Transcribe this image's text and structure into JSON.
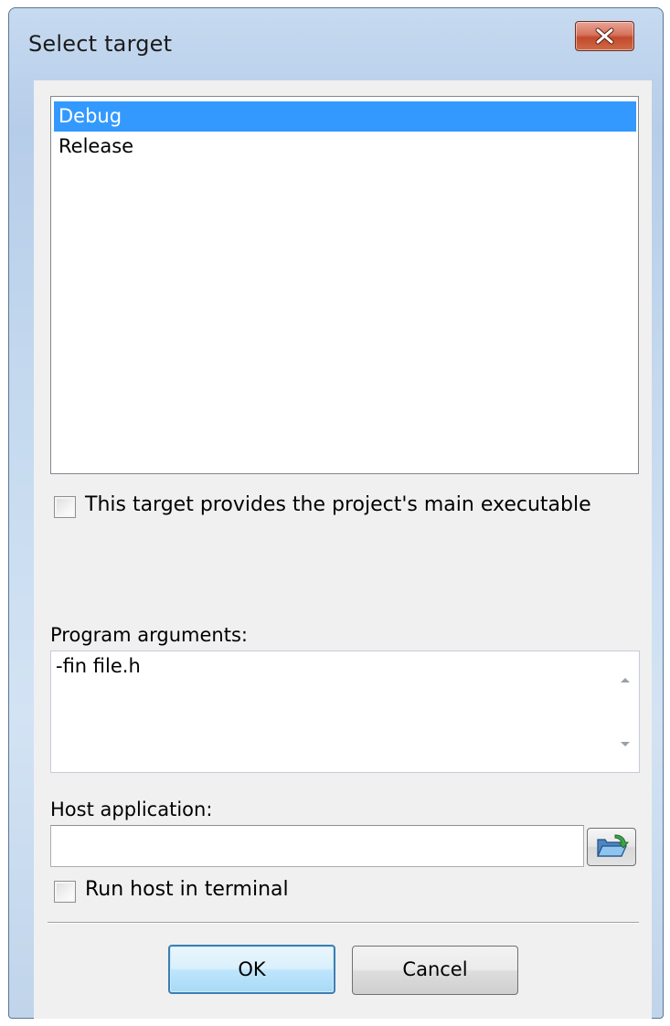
{
  "window": {
    "title": "Select target"
  },
  "targets": {
    "items": [
      {
        "label": "Debug",
        "selected": true
      },
      {
        "label": "Release",
        "selected": false
      }
    ]
  },
  "main_executable": {
    "label": "This target provides the project's main executable",
    "checked": false
  },
  "program_arguments": {
    "label": "Program arguments:",
    "value": "-fin file.h"
  },
  "host_application": {
    "label": "Host application:",
    "value": ""
  },
  "run_in_terminal": {
    "label": "Run host in terminal",
    "checked": false
  },
  "buttons": {
    "ok": "OK",
    "cancel": "Cancel"
  },
  "icons": {
    "close": "close-icon",
    "browse": "open-folder-icon",
    "scroll_up": "scroll-up-arrow-icon",
    "scroll_down": "scroll-down-arrow-icon"
  },
  "colors": {
    "selection": "#3399ff",
    "close_button": "#c24a2c",
    "default_button_border": "#3c7fb1"
  }
}
